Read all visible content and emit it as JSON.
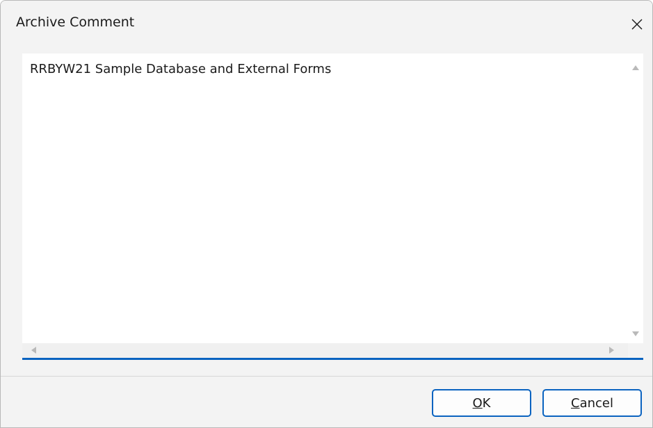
{
  "window": {
    "title": "Archive Comment",
    "close_icon": "close-icon"
  },
  "editor": {
    "text": "RRBYW21 Sample Database and External Forms"
  },
  "buttons": {
    "ok": {
      "mnemonic": "O",
      "rest": "K"
    },
    "cancel": {
      "mnemonic": "C",
      "rest": "ancel"
    }
  },
  "colors": {
    "accent": "#0a63c0",
    "dialog_bg": "#f3f3f3",
    "editor_bg": "#ffffff"
  }
}
